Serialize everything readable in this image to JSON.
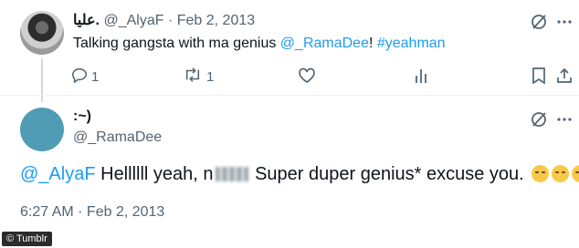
{
  "tweet1": {
    "display_name": "عليا.",
    "handle": "@_AlyaF",
    "separator": "·",
    "date": "Feb 2, 2013",
    "text_before": "Talking gangsta with ma genius ",
    "mention": "@_RamaDee",
    "text_mid": "! ",
    "hashtag": "#yeahman",
    "reply_count": "1",
    "retweet_count": "1"
  },
  "tweet2": {
    "display_name": ":~)",
    "handle": "@_RamaDee",
    "mention": "@_AlyaF",
    "text_before": " Hellllll yeah, n",
    "text_after": " Super duper genius* excuse you.",
    "timestamp": "6:27 AM · Feb 2, 2013"
  },
  "watermark": "© Tumblr",
  "icons": [
    "grok-icon",
    "more-icon",
    "reply-icon",
    "retweet-icon",
    "like-icon",
    "views-icon",
    "bookmark-icon",
    "share-icon",
    "smirk-emoji"
  ],
  "colors": {
    "accent": "#1d9bf0",
    "muted": "#536471",
    "avatar2": "#4f9cb4"
  }
}
